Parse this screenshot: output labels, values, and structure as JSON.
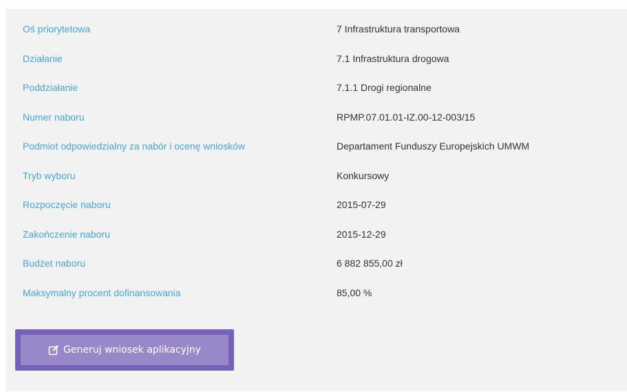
{
  "details": [
    {
      "label": "Oś priorytetowa",
      "value": "7 Infrastruktura transportowa"
    },
    {
      "label": "Działanie",
      "value": "7.1 Infrastruktura drogowa"
    },
    {
      "label": "Poddziałanie",
      "value": "7.1.1 Drogi regionalne"
    },
    {
      "label": "Numer naboru",
      "value": "RPMP.07.01.01-IZ.00-12-003/15"
    },
    {
      "label": "Podmiot odpowiedzialny za nabór i ocenę wniosków",
      "value": "Departament Funduszy Europejskich UMWM"
    },
    {
      "label": "Tryb wyboru",
      "value": "Konkursowy"
    },
    {
      "label": "Rozpoczęcie naboru",
      "value": "2015-07-29"
    },
    {
      "label": "Zakończenie naboru",
      "value": "2015-12-29"
    },
    {
      "label": "Budżet naboru",
      "value": "6 882 855,00 zł"
    },
    {
      "label": "Maksymalny procent dofinansowania",
      "value": "85,00 %"
    }
  ],
  "actions": {
    "generate_label": "Generuj wniosek aplikacyjny",
    "generate_icon": "edit-icon"
  },
  "colors": {
    "label": "#45a6d8",
    "value": "#333333",
    "panel_bg": "#f2f2f2",
    "button_border": "#7462b8",
    "button_bg": "#9888c9"
  }
}
